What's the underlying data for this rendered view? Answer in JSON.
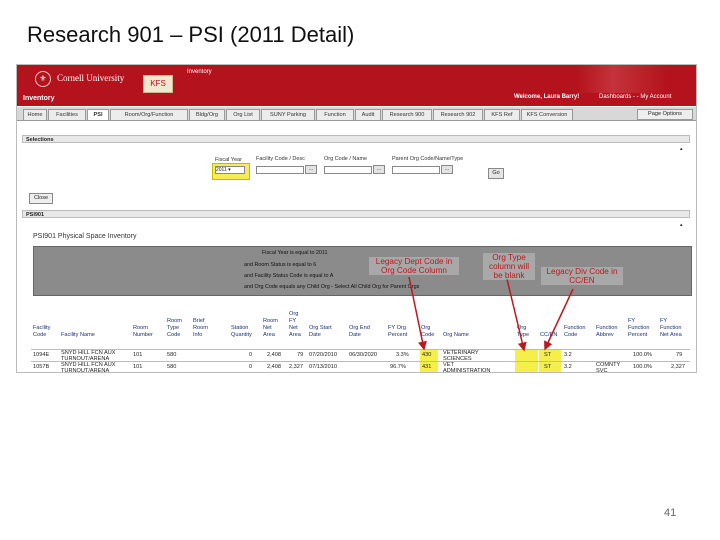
{
  "slide": {
    "title": "Research 901 – PSI (2011 Detail)",
    "page_number": "41"
  },
  "header": {
    "university": "Cornell University",
    "kfs": "KFS",
    "module_top": "Inventory",
    "module": "Inventory",
    "welcome": "Welcome, Laura Barry!",
    "links": "Dashboards - - My Account"
  },
  "tabs": [
    "Home",
    "Facilities",
    "PSI",
    "Room/Org/Function",
    "Bldg/Org",
    "Org List",
    "SUNY Parking",
    "Function",
    "Audit",
    "Research 900",
    "Research 902",
    "KFS Ref",
    "KFS Conversion"
  ],
  "page_options": "Page Options",
  "selections": {
    "header": "Selections",
    "fiscal_year_label": "Fiscal Year",
    "fiscal_year_value": "2011",
    "facility_label": "Facility Code / Desc",
    "org_label": "Org Code / Name",
    "parent_label": "Parent Org Code/Name/Type",
    "go": "Go",
    "close": "Close",
    "ellipsis": "..."
  },
  "psi": {
    "header": "PSI901",
    "report_title": "PSI901 Physical Space Inventory",
    "criteria": [
      "Fiscal Year is equal to 2011",
      "and Room Status is equal to 6",
      "and Facility Status Code is equal to A",
      "and Org Code equals any Child Org - Select All Child Org for Parent Orgs"
    ]
  },
  "table": {
    "headers": [
      "Facility\nCode",
      "Facility Name",
      "Room\nNumber",
      "Room\nType\nCode",
      "Brief\nRoom\nInfo",
      "Station\nQuantity",
      "Room\nNet\nArea",
      "Org\nFY\nNet\nArea",
      "Org Start\nDate",
      "Org End\nDate",
      "FY Org\nPercent",
      "Org\nCode",
      "Org Name",
      "Org\nType",
      "CC/EN",
      "Function\nCode",
      "Function\nAbbrev",
      "FY\nFunction\nPercent",
      "FY\nFunction\nNet Area"
    ],
    "rows": [
      [
        "1094E",
        "SNYD HILL FCN AUX\nTURNOUT/ARENA",
        "101",
        "580",
        "",
        "0",
        "2,408",
        "79",
        "07/20/2010",
        "06/30/2020",
        "3.3%",
        "430",
        "VETERINARY\nSCIENCES",
        "",
        "ST",
        "3.2",
        "",
        "100.0%",
        "79"
      ],
      [
        "1057B",
        "SNYD HILL FCN AUX\nTURNOUT/ARENA",
        "101",
        "580",
        "",
        "0",
        "2,408",
        "2,327",
        "07/13/2010",
        "",
        "96.7%",
        "431",
        "VET\nADMINISTRATION",
        "",
        "ST",
        "3.2",
        "COMNTY\nSVC",
        "100.0%",
        "2,327"
      ]
    ]
  },
  "annotations": {
    "legacy_dept": "Legacy Dept Code in\nOrg Code Column",
    "org_type": "Org Type\ncolumn will\nbe blank",
    "legacy_div": "Legacy Div Code in\nCC/EN"
  },
  "colors": {
    "header_red": "#b4131d",
    "highlight_yellow": "#f6ee49",
    "annotation_red": "#c0161d"
  }
}
